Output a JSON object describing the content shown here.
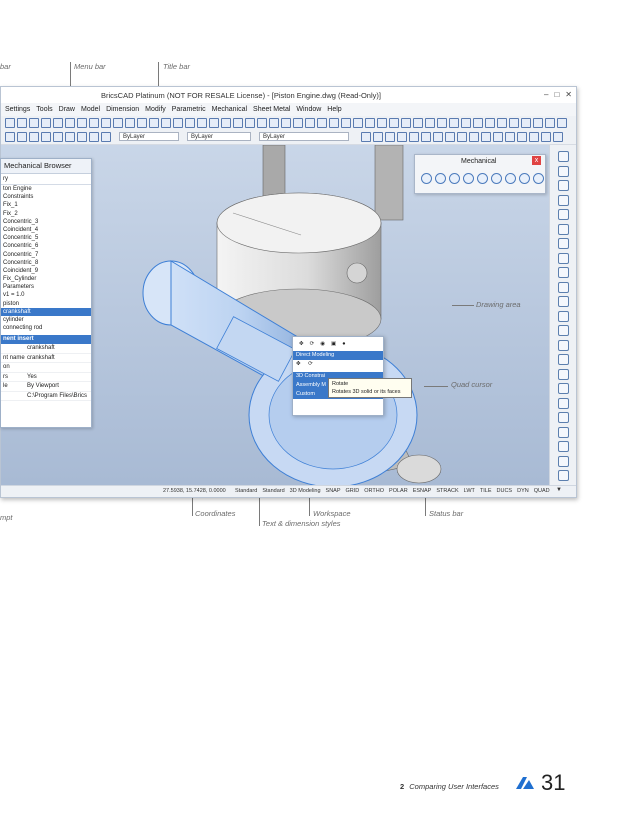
{
  "callouts": {
    "bar_left": "bar",
    "menu_bar": "Menu bar",
    "title_bar": "Title bar",
    "drawing_area": "Drawing area",
    "quad_cursor": "Quad cursor",
    "prompt_left": "mpt",
    "coordinates": "Coordinates",
    "workspace": "Workspace",
    "status_bar": "Status bar",
    "text_dimension_styles": "Text & dimension styles"
  },
  "window": {
    "title": "BricsCAD Platinum (NOT FOR RESALE License) - [Piston Engine.dwg (Read-Only)]",
    "buttons": [
      "–",
      "□",
      "✕"
    ]
  },
  "menu": [
    "Settings",
    "Tools",
    "Draw",
    "Model",
    "Dimension",
    "Modify",
    "Parametric",
    "Mechanical",
    "Sheet Metal",
    "Window",
    "Help"
  ],
  "layer_combos": [
    "ByLayer",
    "ByLayer",
    "ByLayer"
  ],
  "mechanical_panel": {
    "title": "Mechanical",
    "close": "x"
  },
  "browser": {
    "title": "Mechanical Browser",
    "tab": "ry",
    "tree": [
      {
        "label": "ton Engine",
        "selected": false
      },
      {
        "label": "Constraints",
        "selected": false
      },
      {
        "label": "Fix_1",
        "selected": false
      },
      {
        "label": "Fix_2",
        "selected": false
      },
      {
        "label": "Concentric_3",
        "selected": false
      },
      {
        "label": "Coincident_4",
        "selected": false
      },
      {
        "label": "Concentric_5",
        "selected": false
      },
      {
        "label": "Concentric_6",
        "selected": false
      },
      {
        "label": "Concentric_7",
        "selected": false
      },
      {
        "label": "Concentric_8",
        "selected": false
      },
      {
        "label": "Coincident_9",
        "selected": false
      },
      {
        "label": "Fix_Cylinder",
        "selected": false
      },
      {
        "label": "Parameters",
        "selected": false
      },
      {
        "label": "v1 = 1.0",
        "selected": false
      },
      {
        "label": "piston",
        "selected": false
      },
      {
        "label": "crankshaft",
        "selected": true
      },
      {
        "label": "cylinder",
        "selected": false
      },
      {
        "label": "connecting rod",
        "selected": false
      }
    ],
    "props_header": "nent insert",
    "props": [
      {
        "k": "",
        "v": "crankshaft"
      },
      {
        "k": "nt name",
        "v": "crankshaft"
      },
      {
        "k": "on",
        "v": ""
      },
      {
        "k": "rs",
        "v": "Yes"
      },
      {
        "k": "le",
        "v": "By Viewport"
      },
      {
        "k": "",
        "v": "C:\\Program Files\\Brics"
      }
    ]
  },
  "quad": {
    "direct_modeling": "Direct Modeling",
    "rotate": "Rotate",
    "three_d_constraints": "3D Constrai",
    "assembly": "Assembly M",
    "custom": "Custom"
  },
  "tooltip": {
    "line1": "Rotate",
    "line2": "Rotates 3D solid or its faces"
  },
  "status": {
    "coords": "27.5938, 15.7428, 0.0000",
    "items": [
      "Standard",
      "Standard",
      "3D Modeling",
      "SNAP",
      "GRID",
      "ORTHO",
      "POLAR",
      "ESNAP",
      "STRACK",
      "LWT",
      "TILE",
      "DUCS",
      "DYN",
      "QUAD"
    ]
  },
  "footer": {
    "chapter": "2",
    "chapter_title": "Comparing User Interfaces",
    "page": "31"
  },
  "colors": {
    "accent": "#3a78c9",
    "logo": "#1f6fd0",
    "cad_blue": "#3d7fd6"
  }
}
